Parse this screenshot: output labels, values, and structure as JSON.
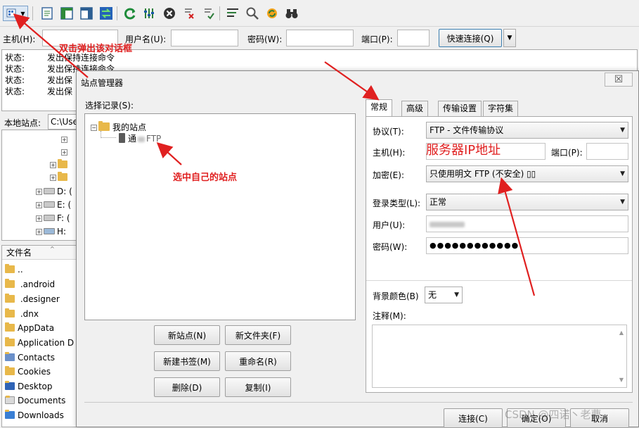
{
  "quickconnect": {
    "host_label": "主机(H):",
    "user_label": "用户名(U):",
    "pass_label": "密码(W):",
    "port_label": "端口(P):",
    "connect_button": "快速连接(Q)"
  },
  "log": {
    "lines": [
      {
        "label": "状态:",
        "text": "发出保持连接命令"
      },
      {
        "label": "状态:",
        "text": "发出保持连接命令"
      },
      {
        "label": "状态:",
        "text": "发出保"
      },
      {
        "label": "状态:",
        "text": "发出保"
      }
    ]
  },
  "local": {
    "site_label": "本地站点:",
    "path_value": "C:\\Use",
    "drives": [
      "D: (",
      "E: (",
      "F: (",
      "H:"
    ],
    "file_header": "文件名",
    "files": [
      "..",
      " .android",
      " .designer",
      " .dnx",
      "AppData",
      "Application D",
      "Contacts",
      "Cookies",
      "Desktop",
      "Documents",
      "Downloads"
    ]
  },
  "dialog": {
    "title": "站点管理器",
    "close_glyph": "☒",
    "select_label": "选择记录(S):",
    "tree_root": "我的站点",
    "tree_site": "通",
    "tree_site_suffix": "FTP",
    "buttons": {
      "new_site": "新站点(N)",
      "new_folder": "新文件夹(F)",
      "new_bookmark": "新建书签(M)",
      "rename": "重命名(R)",
      "delete": "删除(D)",
      "copy": "复制(I)",
      "connect": "连接(C)",
      "ok": "确定(O)",
      "cancel": "取消"
    },
    "tabs": [
      "常规",
      "高级",
      "传输设置",
      "字符集"
    ],
    "general": {
      "protocol_label": "协议(T):",
      "protocol_value": "FTP - 文件传输协议",
      "host_label": "主机(H):",
      "port_label": "端口(P):",
      "encryption_label": "加密(E):",
      "encryption_value": "只使用明文 FTP (不安全) ▯▯",
      "logon_type_label": "登录类型(L):",
      "logon_type_value": "正常",
      "user_label": "用户(U):",
      "password_label": "密码(W):",
      "password_value": "●●●●●●●●●●●●",
      "bg_color_label": "背景颜色(B)",
      "bg_color_value": "无",
      "comment_label": "注释(M):"
    }
  },
  "annotations": {
    "double_click": "双击弹出该对话框",
    "select_site": "选中自己的站点",
    "server_ip": "服务器IP地址",
    "color": "#e02020"
  },
  "watermark": "CSDN @四诺丶老曹"
}
